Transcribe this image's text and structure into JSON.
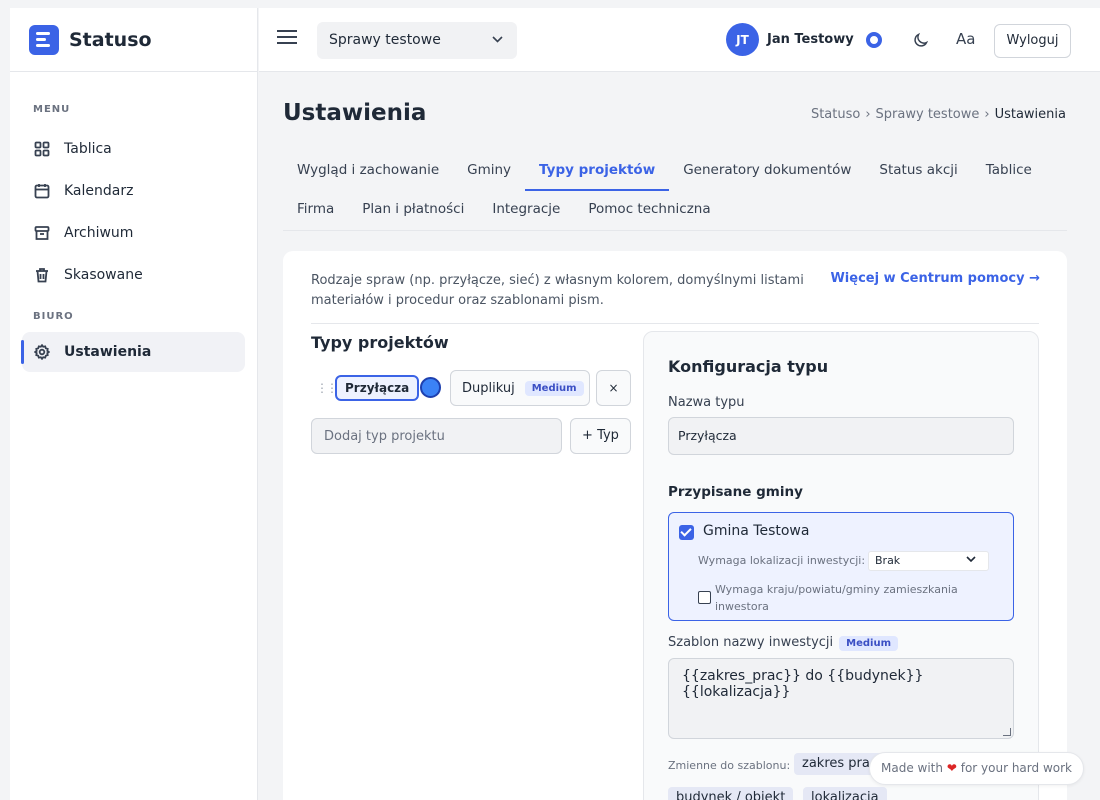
{
  "brand": {
    "name": "Statuso"
  },
  "sidebar": {
    "sections": [
      {
        "title": "MENU",
        "items": [
          {
            "label": "Tablica",
            "icon": "grid-icon"
          },
          {
            "label": "Kalendarz",
            "icon": "calendar-icon"
          },
          {
            "label": "Archiwum",
            "icon": "archive-icon"
          },
          {
            "label": "Skasowane",
            "icon": "trash-icon"
          }
        ]
      },
      {
        "title": "BIURO",
        "items": [
          {
            "label": "Ustawienia",
            "icon": "gear-icon",
            "active": true
          }
        ]
      }
    ]
  },
  "topbar": {
    "project_select": "Sprawy testowe",
    "user": {
      "initials": "JT",
      "name": "Jan Testowy"
    },
    "font_toggle": "Aa",
    "logout": "Wyloguj"
  },
  "page": {
    "title": "Ustawienia",
    "breadcrumb": [
      "Statuso",
      "Sprawy testowe",
      "Ustawienia"
    ],
    "breadcrumb_sep": "›"
  },
  "tabs": {
    "row1": [
      "Wygląd i zachowanie",
      "Gminy",
      "Typy projektów",
      "Generatory dokumentów",
      "Status akcji",
      "Tablice"
    ],
    "row2": [
      "Firma",
      "Plan i płatności",
      "Integracje",
      "Pomoc techniczna"
    ],
    "active": "Typy projektów"
  },
  "card": {
    "intro": "Rodzaje spraw (np. przyłącze, sieć) z własnym kolorem, domyślnymi listami materiałów i procedur oraz szablonami pism.",
    "help_link": "Więcej w Centrum pomocy →",
    "types_title": "Typy projektów",
    "type_chip": "Przyłącza",
    "type_color": "#3b82f6",
    "duplicate_btn": "Duplikuj",
    "duplicate_badge": "Medium",
    "remove_btn": "×",
    "add_placeholder": "Dodaj typ projektu",
    "add_btn": "+ Typ"
  },
  "config": {
    "title": "Konfiguracja typu",
    "name_label": "Nazwa typu",
    "name_value": "Przyłącza",
    "gminy_title": "Przypisane gminy",
    "gmina": {
      "name": "Gmina Testowa",
      "checked": true,
      "lok_label": "Wymaga lokalizacji inwestycji:",
      "lok_value": "Brak",
      "kraj_label": "Wymaga kraju/powiatu/gminy zamieszkania inwestora",
      "kraj_checked": false
    },
    "template_label": "Szablon nazwy inwestycji",
    "template_badge": "Medium",
    "template_value": "{{zakres_prac}} do {{budynek}} {{lokalizacja}}",
    "vars_label": "Zmienne do szablonu:",
    "vars": [
      "zakres prac",
      "budynek / obiekt",
      "lokalizacja"
    ]
  },
  "footer": {
    "made_with_pre": "Made with",
    "made_with_post": "for your hard work"
  },
  "colors": {
    "accent": "#3b63e6"
  }
}
